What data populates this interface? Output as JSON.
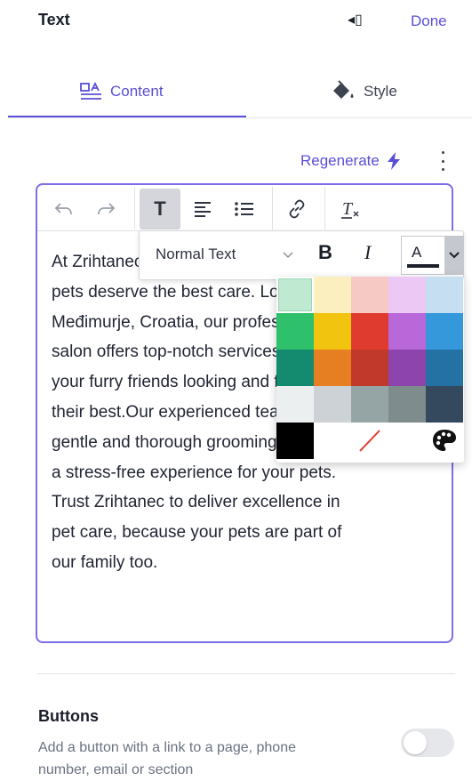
{
  "header": {
    "title": "Text",
    "back_icon": "◂▯",
    "done_label": "Done"
  },
  "tabs": [
    {
      "label": "Content",
      "icon": "text-layout-icon",
      "active": true
    },
    {
      "label": "Style",
      "icon": "paint-bucket-icon",
      "active": false
    }
  ],
  "regenerate": {
    "label": "Regenerate",
    "icon": "lightning-icon"
  },
  "editor": {
    "toolbar": {
      "undo": "↶",
      "redo": "↷",
      "text_style": "T",
      "align": "≡",
      "list": "☰",
      "link": "🔗",
      "clear_format": "T"
    },
    "content": "At Zrihtanec, we believe your\npets deserve the best care. Located in\nMeđimurje, Croatia, our professional\nsalon offers top-notch services to keep\nyour furry friends looking and feeling\ntheir best.Our experienced team ensures\ngentle and thorough grooming, providing\na stress-free experience for your pets.\nTrust Zrihtanec to deliver excellence in\npet care, because your pets are part of\nour family too."
  },
  "format_popup": {
    "block_type": "Normal Text",
    "bold_label": "B",
    "italic_label": "I",
    "color_label": "A"
  },
  "palette": {
    "rows": [
      [
        "#bfe9d1",
        "#fcefbf",
        "#f7c9c5",
        "#ebc9f4",
        "#c5def2"
      ],
      [
        "#2ec06b",
        "#f1c40f",
        "#e03b2f",
        "#b868d8",
        "#3498db"
      ],
      [
        "#148a6f",
        "#e67e22",
        "#c0392b",
        "#8e44ad",
        "#2471a3"
      ],
      [
        "#eceff0",
        "#cdd2d6",
        "#95a5a6",
        "#7f8c8d",
        "#34495e"
      ]
    ],
    "black": "#000000",
    "no_color_icon": "slash-icon",
    "custom_icon": "palette-icon"
  },
  "buttons_section": {
    "title": "Buttons",
    "description": "Add a button with a link to a page, phone\nnumber, email or section",
    "toggle_on": false
  },
  "colors": {
    "accent": "#5b4fd8",
    "editor_border": "#7b6ee8"
  }
}
